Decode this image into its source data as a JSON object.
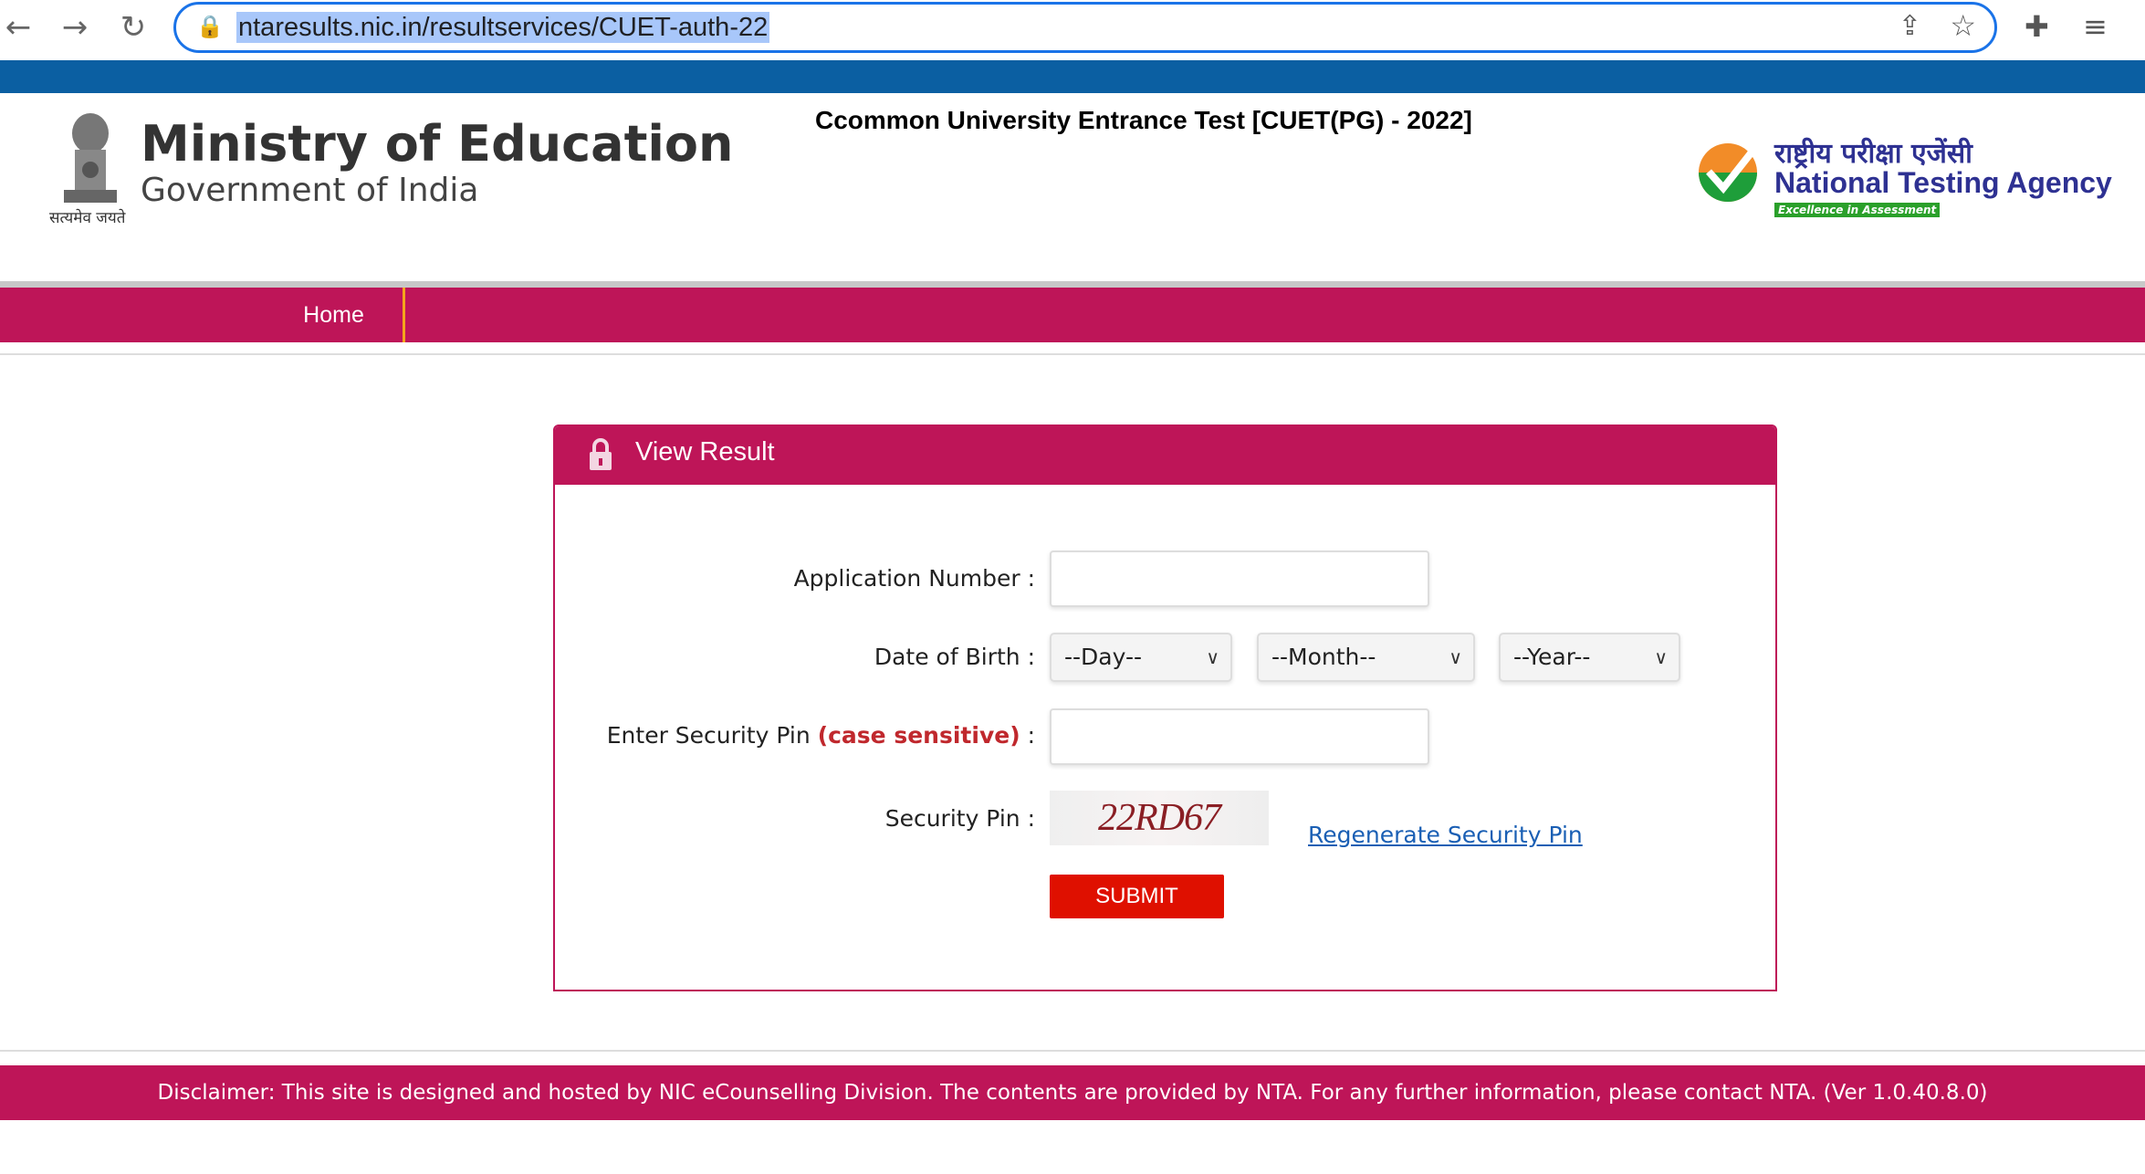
{
  "browser": {
    "url": "ntaresults.nic.in/resultservices/CUET-auth-22"
  },
  "header": {
    "ministry_title": "Ministry of Education",
    "ministry_subtitle": "Government of India",
    "emblem_motto": "सत्यमेव जयते",
    "exam_title": "Ccommon University Entrance Test [CUET(PG) - 2022]",
    "nta_hindi": "राष्ट्रीय परीक्षा एजेंसी",
    "nta_name": "National Testing Agency",
    "nta_tagline": "Excellence in Assessment"
  },
  "nav": {
    "home": "Home"
  },
  "form": {
    "title": "View Result",
    "application_label": "Application Number :",
    "application_value": "",
    "dob_label": "Date of Birth :",
    "day": "--Day--",
    "month": "--Month--",
    "year": "--Year--",
    "pin_label": "Enter Security Pin",
    "pin_note": "(case sensitive)",
    "pin_colon": " :",
    "pin_value": "",
    "captcha_label": "Security Pin :",
    "captcha_text": "22RD67",
    "regenerate": "Regenerate Security Pin",
    "submit": "SUBMIT"
  },
  "footer": {
    "disclaimer": "Disclaimer: This site is designed and hosted by NIC eCounselling Division. The contents are provided by NTA. For any further information, please contact NTA. (Ver 1.0.40.8.0)"
  },
  "colors": {
    "brand": "#be1558",
    "topbar": "#0b5fa2",
    "submit": "#df1000",
    "link": "#1a5fb4"
  }
}
